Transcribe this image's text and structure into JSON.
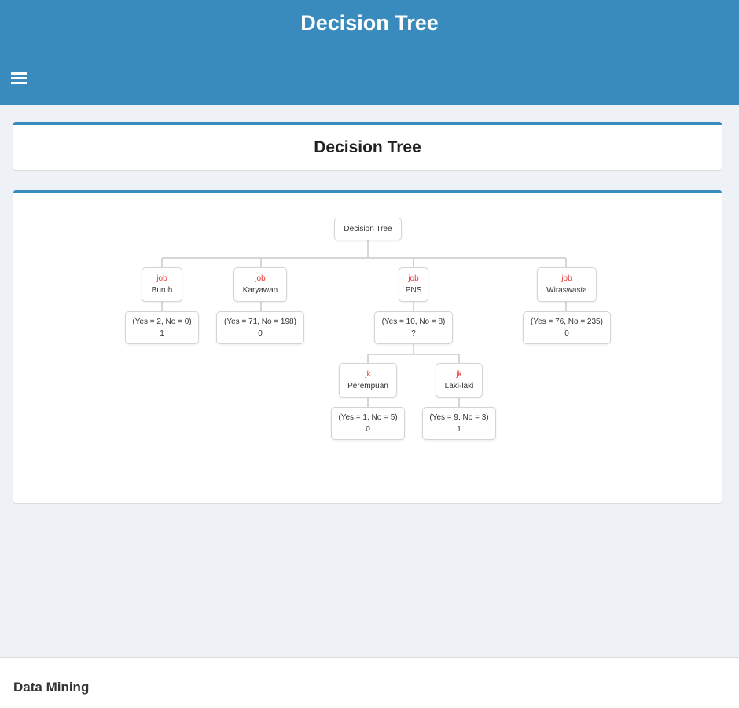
{
  "header": {
    "title": "Decision Tree"
  },
  "page": {
    "title": "Decision Tree"
  },
  "tree": {
    "root": "Decision Tree",
    "branches": [
      {
        "attr": "job",
        "value": "Buruh",
        "result": "(Yes = 2, No = 0)",
        "label": "1"
      },
      {
        "attr": "job",
        "value": "Karyawan",
        "result": "(Yes = 71, No = 198)",
        "label": "0"
      },
      {
        "attr": "job",
        "value": "PNS",
        "result": "(Yes = 10, No = 8)",
        "label": "?"
      },
      {
        "attr": "job",
        "value": "Wiraswasta",
        "result": "(Yes = 76, No = 235)",
        "label": "0"
      }
    ],
    "sub_branches": [
      {
        "attr": "jk",
        "value": "Perempuan",
        "result": "(Yes = 1, No = 5)",
        "label": "0"
      },
      {
        "attr": "jk",
        "value": "Laki-laki",
        "result": "(Yes = 9, No = 3)",
        "label": "1"
      }
    ]
  },
  "footer": {
    "text": "Data Mining"
  }
}
